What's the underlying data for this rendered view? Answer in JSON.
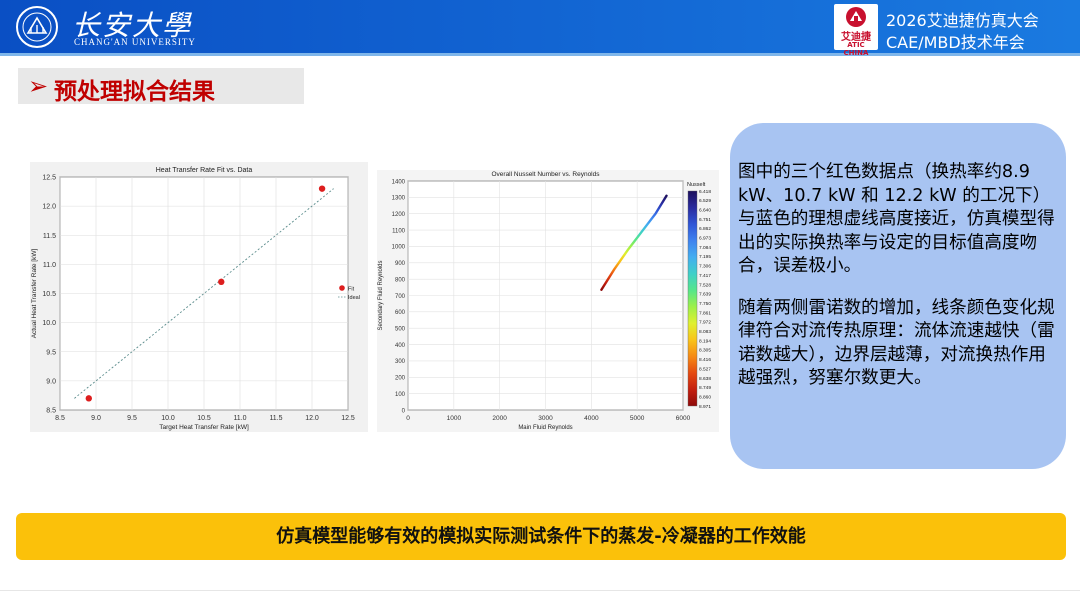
{
  "header": {
    "university_cn": "长安大學",
    "university_en": "CHANG'AN UNIVERSITY",
    "conf_logo_name": "艾迪捷",
    "conf_logo_sub": "ATIC CHINA",
    "conf_line1": "2026艾迪捷仿真大会",
    "conf_line2": "CAE/MBD技术年会",
    "colors": {
      "bar": "#0a4fc4",
      "accent": "#c00000",
      "highlight": "#fbc10a",
      "bubble": "#a8c4f2"
    }
  },
  "section": {
    "arrow": "➢",
    "title": "预处理拟合结果"
  },
  "charts_text": {
    "description": [
      "图中的三个红色数据点（换热率约8.9 kW、10.7 kW 和 12.2 kW 的工况下）与蓝色的理想虚线高度接近，仿真模型得出的实际换热率与设定的目标值高度吻合，误差极小。",
      "随着两侧雷诺数的增加，线条颜色变化规律符合对流传热原理：流体流速越快（雷诺数越大），边界层越薄，对流换热作用越强烈，努塞尔数更大。"
    ],
    "summary": "仿真模型能够有效的模拟实际测试条件下的蒸发-冷凝器的工作效能"
  },
  "chart_data": [
    {
      "type": "scatter",
      "title": "Heat Transfer Rate Fit vs. Data",
      "xlabel": "Target Heat Transfer Rate [kW]",
      "ylabel": "Actual Heat Transfer Rate [kW]",
      "xlim": [
        8.5,
        12.5
      ],
      "ylim": [
        8.5,
        12.5
      ],
      "xticks": [
        "8.5",
        "9.0",
        "9.5",
        "10.0",
        "10.5",
        "11.0",
        "11.5",
        "12.0",
        "12.5"
      ],
      "yticks": [
        "8.5",
        "9.0",
        "9.5",
        "10.0",
        "10.5",
        "11.0",
        "11.5",
        "12.0",
        "12.5"
      ],
      "grid": true,
      "legend_position": "right",
      "series": [
        {
          "name": "Fit",
          "style": "marker",
          "color": "#dd1e1e",
          "x": [
            8.9,
            10.74,
            12.14
          ],
          "y": [
            8.7,
            10.7,
            12.3
          ]
        },
        {
          "name": "Ideal",
          "style": "dashed",
          "color": "#5b8c8c",
          "x": [
            8.7,
            12.3
          ],
          "y": [
            8.7,
            12.3
          ]
        }
      ]
    },
    {
      "type": "line",
      "title": "Overall Nusselt Number vs. Reynolds",
      "xlabel": "Main Fluid Reynolds",
      "ylabel": "Secondary Fluid Reynolds",
      "xlim": [
        0,
        6000
      ],
      "ylim": [
        0,
        1400
      ],
      "xticks": [
        "0",
        "1000",
        "2000",
        "3000",
        "4000",
        "5000",
        "6000"
      ],
      "yticks": [
        "0",
        "100",
        "200",
        "300",
        "400",
        "500",
        "600",
        "700",
        "800",
        "900",
        "1000",
        "1100",
        "1200",
        "1300",
        "1400"
      ],
      "grid": true,
      "colorbar": {
        "label": "Nusselt",
        "ticks": [
          "6.418",
          "6.529",
          "6.640",
          "6.751",
          "6.862",
          "6.973",
          "7.084",
          "7.195",
          "7.306",
          "7.417",
          "7.528",
          "7.639",
          "7.750",
          "7.861",
          "7.972",
          "8.083",
          "8.194",
          "8.305",
          "8.416",
          "8.527",
          "8.638",
          "8.749",
          "8.860",
          "8.971"
        ],
        "colors": [
          "#1c0f5c",
          "#2a2b9e",
          "#2f55d6",
          "#3e82ef",
          "#43aef0",
          "#3fd0c8",
          "#55e68a",
          "#9cf04a",
          "#dff030",
          "#f9c419",
          "#f68a14",
          "#e54a11",
          "#c41f0f",
          "#8e0a0a"
        ]
      },
      "series": [
        {
          "name": "",
          "x": [
            4220,
            4500,
            4800,
            5100,
            5400,
            5640
          ],
          "y": [
            735,
            860,
            980,
            1090,
            1200,
            1310
          ]
        }
      ]
    }
  ]
}
